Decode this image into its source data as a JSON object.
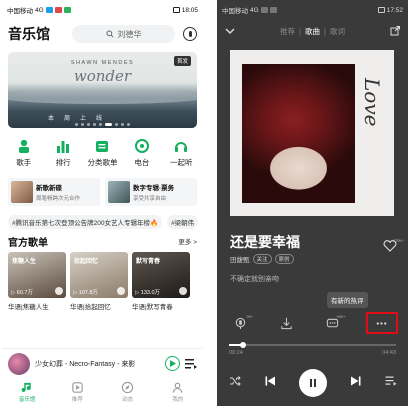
{
  "left": {
    "status": {
      "carrier": "中国移动",
      "signal": "4G",
      "time": "18:05"
    },
    "header": {
      "title": "音乐馆",
      "search_placeholder": "刘德华"
    },
    "banner": {
      "artist": "SHAWN MENDES",
      "album_title": "wonder",
      "tag": "首发",
      "captions": [
        "本",
        "周",
        "上",
        "线"
      ]
    },
    "icons": [
      {
        "label": "歌手",
        "icon": "singer-icon"
      },
      {
        "label": "排行",
        "icon": "chart-icon"
      },
      {
        "label": "分类歌单",
        "icon": "category-icon"
      },
      {
        "label": "电台",
        "icon": "radio-icon"
      },
      {
        "label": "一起听",
        "icon": "listen-together-icon"
      }
    ],
    "cards": [
      {
        "title": "新歌新碟",
        "subtitle": "周笔畅跨次元合作"
      },
      {
        "title": "数字专辑·票务",
        "subtitle": "享受共享自由"
      }
    ],
    "hashtags": [
      "#腾讯音乐第七次登顶公告牌200女艺人专辑年榜🔥",
      "#梁朝伟"
    ],
    "section": {
      "title": "官方歌单",
      "more": "更多 >"
    },
    "playlists": [
      {
        "cover_caption": "焦糖人生",
        "count": "▷ 60.7万",
        "title": "华语|焦糖人生"
      },
      {
        "cover_caption": "拾起回忆",
        "count": "▷ 107.8万",
        "title": "华语|拾起回忆"
      },
      {
        "cover_caption": "默写青春",
        "count": "▷ 133.0万",
        "title": "华语|默写青春"
      }
    ],
    "miniplayer": {
      "title": "少女幻葬 - Necro-Fantasy - 来影"
    },
    "tabs": [
      {
        "label": "音乐馆",
        "active": true
      },
      {
        "label": "推荐",
        "active": false
      },
      {
        "label": "动态",
        "active": false
      },
      {
        "label": "我的",
        "active": false
      }
    ]
  },
  "right": {
    "status": {
      "carrier": "中国移动",
      "signal": "4G",
      "time": "17:52"
    },
    "tabs": [
      {
        "label": "推荐",
        "active": false
      },
      {
        "label": "歌曲",
        "active": true
      },
      {
        "label": "歌词",
        "active": false
      }
    ],
    "cover_text": "Love",
    "song": {
      "title": "还是要幸福",
      "artist": "田馥甄",
      "follow": "关注",
      "badge": "原创",
      "lyric": "不确定就别亲吻"
    },
    "like_count": "10w+",
    "tooltip": "有新的热评",
    "action_badges": {
      "effect": "99+",
      "comments": "999+"
    },
    "progress": {
      "current": "00:24",
      "total": "04:43",
      "fraction": 0.085
    }
  },
  "colors": {
    "accent_green": "#11b15f",
    "highlight_red": "#e10c16",
    "player_bg": "#3a3a3a"
  }
}
